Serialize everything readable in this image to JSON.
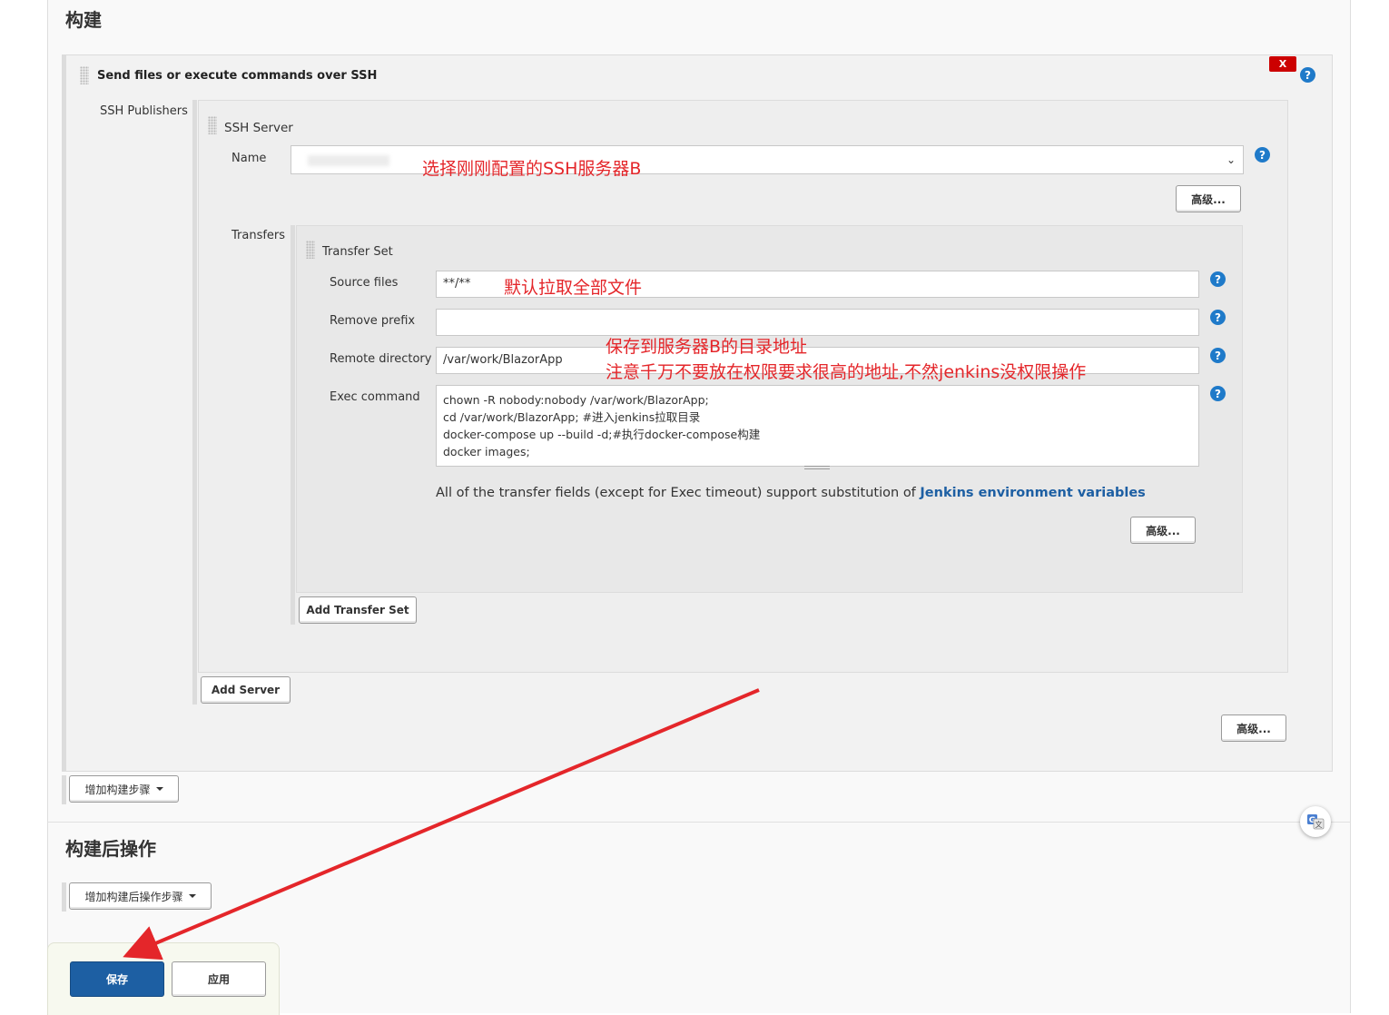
{
  "build": {
    "section_title": "构建",
    "step": {
      "title": "Send files or execute commands over SSH",
      "delete_label": "X",
      "publishers_label": "SSH Publishers",
      "server": {
        "title": "SSH Server",
        "name_label": "Name",
        "advanced_label": "高级...",
        "transfers_label": "Transfers",
        "transfer_set": {
          "title": "Transfer Set",
          "source_files_label": "Source files",
          "source_files_value": "**/**",
          "remove_prefix_label": "Remove prefix",
          "remove_prefix_value": "",
          "remote_directory_label": "Remote directory",
          "remote_directory_value": "/var/work/BlazorApp",
          "exec_command_label": "Exec command",
          "exec_command_value": "chown -R nobody:nobody /var/work/BlazorApp;\ncd /var/work/BlazorApp; #进入jenkins拉取目录\ndocker-compose up --build -d;#执行docker-compose构建\ndocker images;",
          "note_prefix": "All of the transfer fields (except for Exec timeout) support substitution of ",
          "note_link": "Jenkins environment variables",
          "advanced_label": "高级..."
        },
        "add_transfer_set_label": "Add Transfer Set"
      },
      "add_server_label": "Add Server",
      "advanced_label": "高级..."
    },
    "add_step_label": "增加构建步骤"
  },
  "post_build": {
    "section_title": "构建后操作",
    "add_step_label": "增加构建后操作步骤"
  },
  "footer": {
    "save_label": "保存",
    "apply_label": "应用"
  },
  "annotations": {
    "name_hint": "选择刚刚配置的SSH服务器B",
    "source_hint": "默认拉取全部文件",
    "remote_hint_line1": "保存到服务器B的目录地址",
    "remote_hint_line2": "注意千万不要放在权限要求很高的地址,不然jenkins没权限操作"
  },
  "icons": {
    "help": "help-icon",
    "translate": "translate-icon",
    "grip": "drag-handle-icon"
  },
  "colors": {
    "accent": "#1f7ac9",
    "save_button": "#1d5fa3",
    "delete_button": "#cc0000",
    "annotation": "#e4262a",
    "link": "#1d5fa3"
  }
}
